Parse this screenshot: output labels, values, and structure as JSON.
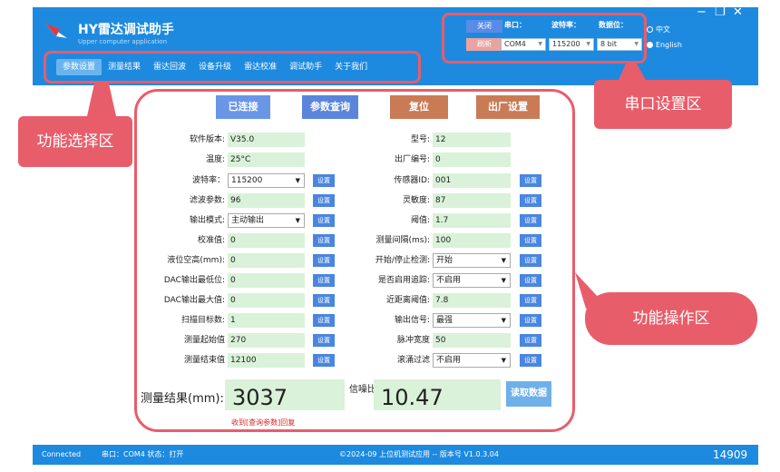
{
  "app": {
    "title": "HY雷达调试助手",
    "subtitle": "Upper computer application"
  },
  "nav": {
    "tabs": [
      "参数设置",
      "测量结果",
      "雷达回波",
      "设备升级",
      "雷达校准",
      "调试助手",
      "关于我们"
    ],
    "active_index": 0
  },
  "serial": {
    "close_label": "关闭",
    "refresh_label": "刷新",
    "port_header": "串口：",
    "baud_header": "波特率：",
    "databits_header": "数据位：",
    "port_value": "COM4",
    "baud_value": "115200",
    "databits_value": "8 bit"
  },
  "language": {
    "chinese": "中文",
    "english": "English",
    "selected": "english"
  },
  "annotations": {
    "func_select": "功能选择区",
    "serial_settings": "串口设置区",
    "func_operation": "功能操作区"
  },
  "actions": {
    "connected": "已连接",
    "query": "参数查询",
    "reset": "复位",
    "factory": "出厂设置"
  },
  "set_label": "设置",
  "left_params": [
    {
      "label": "软件版本:",
      "value": "V35.0"
    },
    {
      "label": "温度:",
      "value": "25°C"
    },
    {
      "label": "波特率：",
      "value": "115200"
    },
    {
      "label": "滤波参数:",
      "value": "96"
    },
    {
      "label": "输出模式:",
      "value": "主动输出"
    },
    {
      "label": "校准值:",
      "value": "0"
    },
    {
      "label": "液位空高(mm):",
      "value": "0"
    },
    {
      "label": "DAC输出最低位:",
      "value": "0"
    },
    {
      "label": "DAC输出最大值:",
      "value": "0"
    },
    {
      "label": "扫描目标数:",
      "value": "1"
    },
    {
      "label": "测量起始值",
      "value": "270"
    },
    {
      "label": "测量结束值",
      "value": "12100"
    }
  ],
  "right_params": [
    {
      "label": "型号:",
      "value": "12"
    },
    {
      "label": "出厂编号:",
      "value": "0"
    },
    {
      "label": "传感器ID:",
      "value": "001"
    },
    {
      "label": "灵敏度:",
      "value": "87"
    },
    {
      "label": "阈值:",
      "value": "1.7"
    },
    {
      "label": "测量间隔(ms):",
      "value": "100"
    },
    {
      "label": "开始/停止检测:",
      "value": "开始"
    },
    {
      "label": "是否启用追踪:",
      "value": "不启用"
    },
    {
      "label": "近距离阈值:",
      "value": "7.8"
    },
    {
      "label": "输出信号:",
      "value": "最强"
    },
    {
      "label": "脉冲宽度",
      "value": "50"
    },
    {
      "label": "滚涌过滤",
      "value": "不启用"
    }
  ],
  "result": {
    "label": "测量结果(mm):",
    "value": "3037",
    "snr_label": "信噪比",
    "snr_value": "10.47",
    "read_label": "读取数据"
  },
  "status_message": "收到[查询参数]回复",
  "statusbar": {
    "connection": "Connected",
    "port_status": "串口：COM4  状态：打开",
    "copyright": "©2024-09 上位机测试应用 -- 版本号 V1.0.3.04",
    "counter": "14909"
  },
  "colors": {
    "header_blue": "#1d8ae0",
    "annotation_red": "#e85d6a",
    "field_green": "#d9f2d9"
  }
}
